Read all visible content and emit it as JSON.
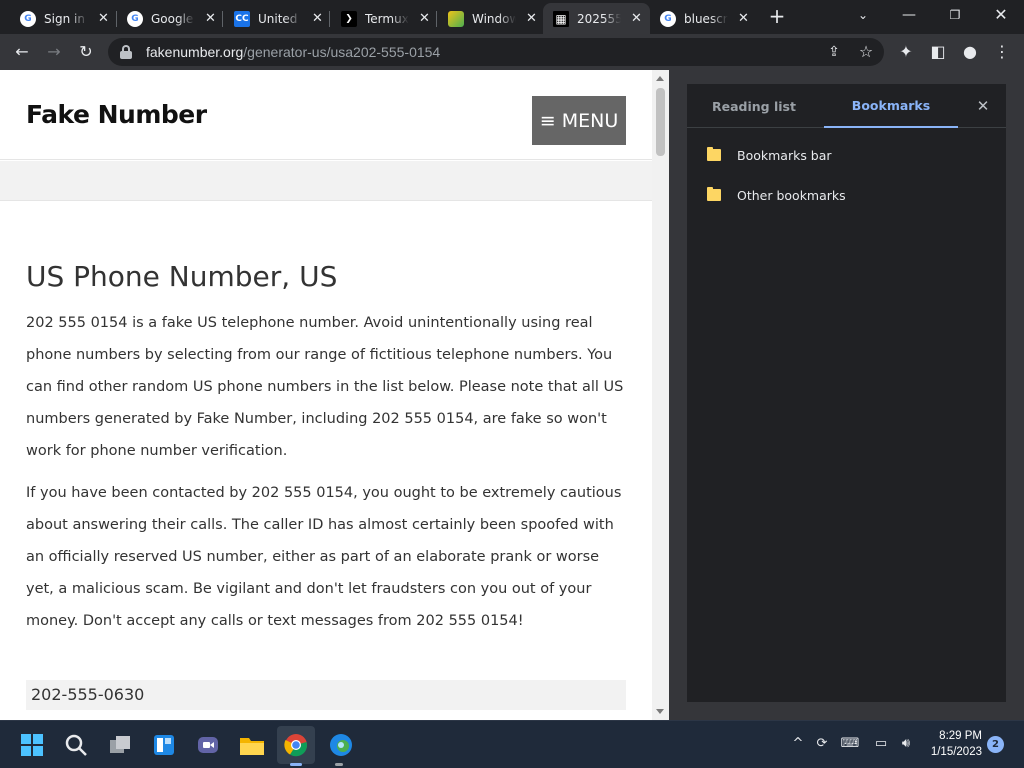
{
  "tabs": [
    {
      "title": "Sign in",
      "icon": "google-icon",
      "fav_bg": "#ffffff",
      "fav_text": "G",
      "fav_color": "#4285f4"
    },
    {
      "title": "Google",
      "icon": "google-icon",
      "fav_bg": "#ffffff",
      "fav_text": "G",
      "fav_color": "#4285f4"
    },
    {
      "title": "United S",
      "icon": "cc-icon",
      "fav_bg": "#1a73e8",
      "fav_text": "CC",
      "fav_color": "#ffffff"
    },
    {
      "title": "Termux",
      "icon": "terminal-icon",
      "fav_bg": "#000000",
      "fav_text": "❯",
      "fav_color": "#ffffff"
    },
    {
      "title": "Window",
      "icon": "windows-app-icon",
      "fav_bg": "#6b8e23",
      "fav_text": "",
      "fav_color": "#ffffff"
    },
    {
      "title": "202555",
      "icon": "grid-icon",
      "fav_bg": "#000000",
      "fav_text": "▦",
      "fav_color": "#ffffff",
      "active": true
    },
    {
      "title": "bluescri",
      "icon": "google-icon",
      "fav_bg": "#ffffff",
      "fav_text": "G",
      "fav_color": "#4285f4"
    }
  ],
  "url": {
    "host": "fakenumber.org",
    "path": "/generator-us/usa202-555-0154"
  },
  "site": {
    "logo": "Fake Number",
    "menu_label": "≡ MENU",
    "heading": "US Phone Number, US",
    "paragraphs": [
      "202 555 0154 is a fake US telephone number. Avoid unintentionally using real phone numbers by selecting from our range of fictitious telephone numbers. You can find other random US phone numbers in the list below. Please note that all US numbers generated by Fake Number, including 202 555 0154, are fake so won't work for phone number verification.",
      "If you have been contacted by 202 555 0154, you ought to be extremely cautious about answering their calls. The caller ID has almost certainly been spoofed with an officially reserved US number, either as part of an elaborate prank or worse yet, a malicious scam. Be vigilant and don't let fraudsters con you out of your money. Don't accept any calls or text messages from 202 555 0154!"
    ],
    "list_first": "202-555-0630"
  },
  "side_panel": {
    "tab_reading": "Reading list",
    "tab_bookmarks": "Bookmarks",
    "items": [
      "Bookmarks bar",
      "Other bookmarks"
    ]
  },
  "taskbar": {
    "time": "8:29 PM",
    "date": "1/15/2023",
    "notification_count": "2"
  },
  "colors": {
    "accent": "#8ab4f8",
    "folder": "#fdd663",
    "menu_bg": "#666666"
  }
}
